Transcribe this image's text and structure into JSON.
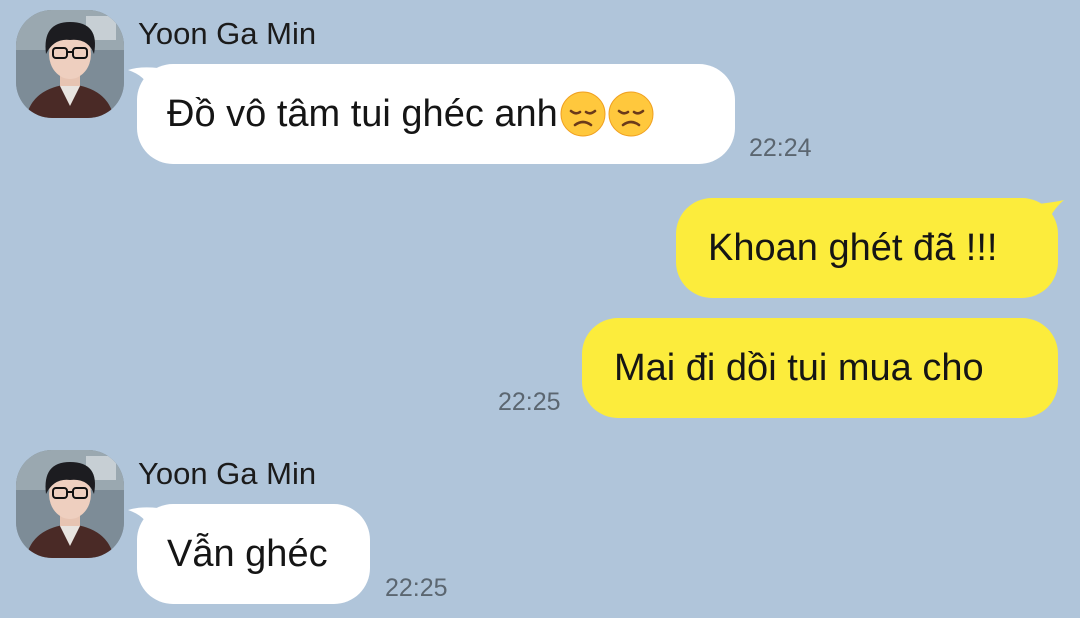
{
  "colors": {
    "background": "#b0c5da",
    "incoming_bubble": "#ffffff",
    "outgoing_bubble": "#fcec3c",
    "timestamp": "#5b6670"
  },
  "messages": [
    {
      "direction": "incoming",
      "sender": "Yoon Ga Min",
      "avatar": "profile-photo",
      "text": "Đồ vô tâm tui ghéc anh",
      "emojis": [
        "disappointed-face",
        "disappointed-face"
      ],
      "time": "22:24"
    },
    {
      "direction": "outgoing",
      "text": "Khoan ghét đã !!!",
      "time": ""
    },
    {
      "direction": "outgoing",
      "text": "Mai đi dồi tui mua cho",
      "time": "22:25"
    },
    {
      "direction": "incoming",
      "sender": "Yoon Ga Min",
      "avatar": "profile-photo",
      "text": "Vẫn ghéc",
      "time": "22:25"
    }
  ]
}
